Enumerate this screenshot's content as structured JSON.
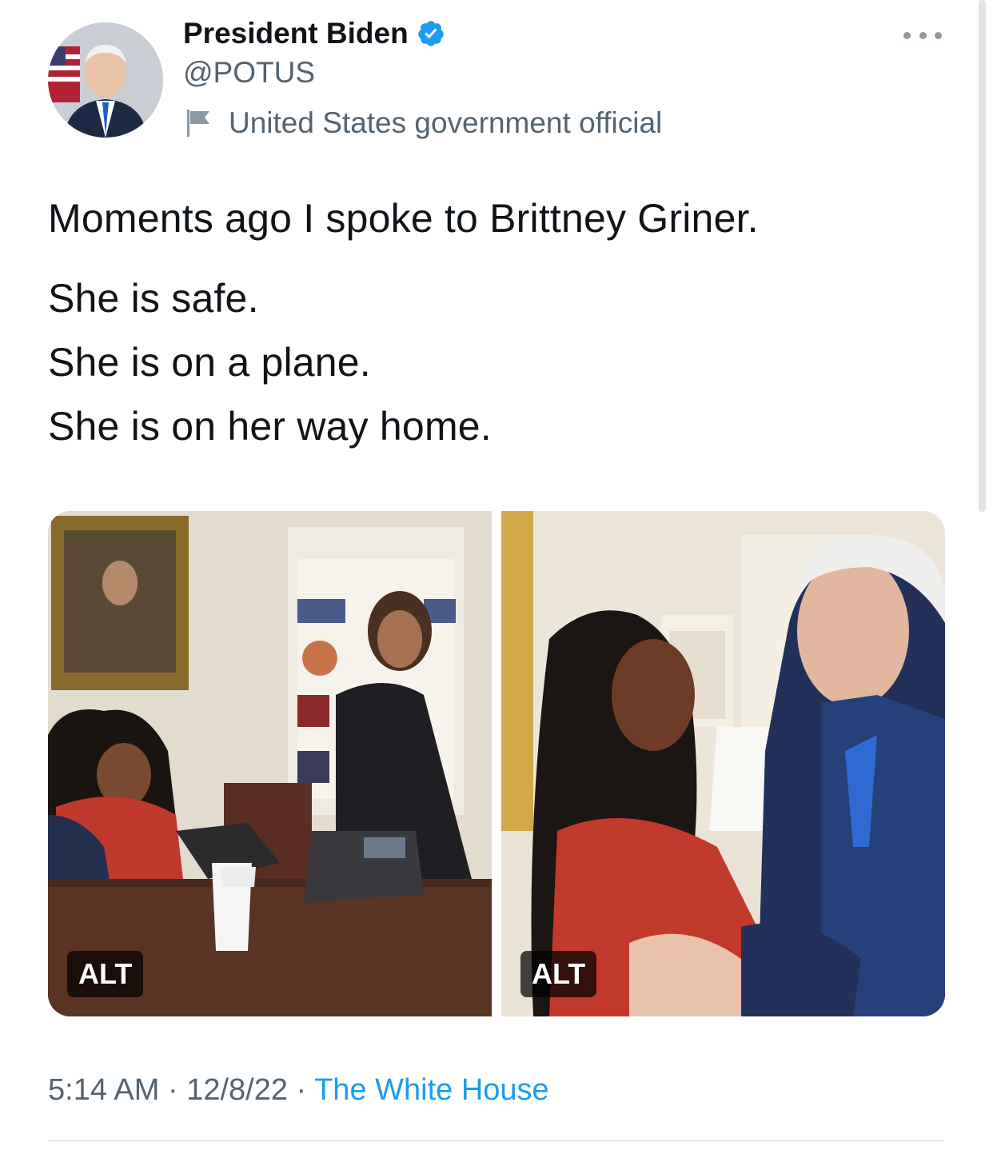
{
  "author": {
    "name": "President Biden",
    "handle": "@POTUS",
    "label": "United States government official",
    "verified": true,
    "avatar_icon": "profile-photo"
  },
  "tweet": {
    "lines": [
      "Moments ago I spoke to Brittney Griner.",
      "She is safe.",
      "She is on a plane.",
      "She is on her way home."
    ]
  },
  "media": [
    {
      "alt_badge": "ALT"
    },
    {
      "alt_badge": "ALT"
    }
  ],
  "meta": {
    "time": "5:14 AM",
    "separator1": " · ",
    "date": "12/8/22",
    "separator2": " · ",
    "source": "The White House"
  },
  "colors": {
    "accent": "#1d9bf0",
    "secondary_text": "#536471",
    "primary_text": "#0f1419"
  }
}
